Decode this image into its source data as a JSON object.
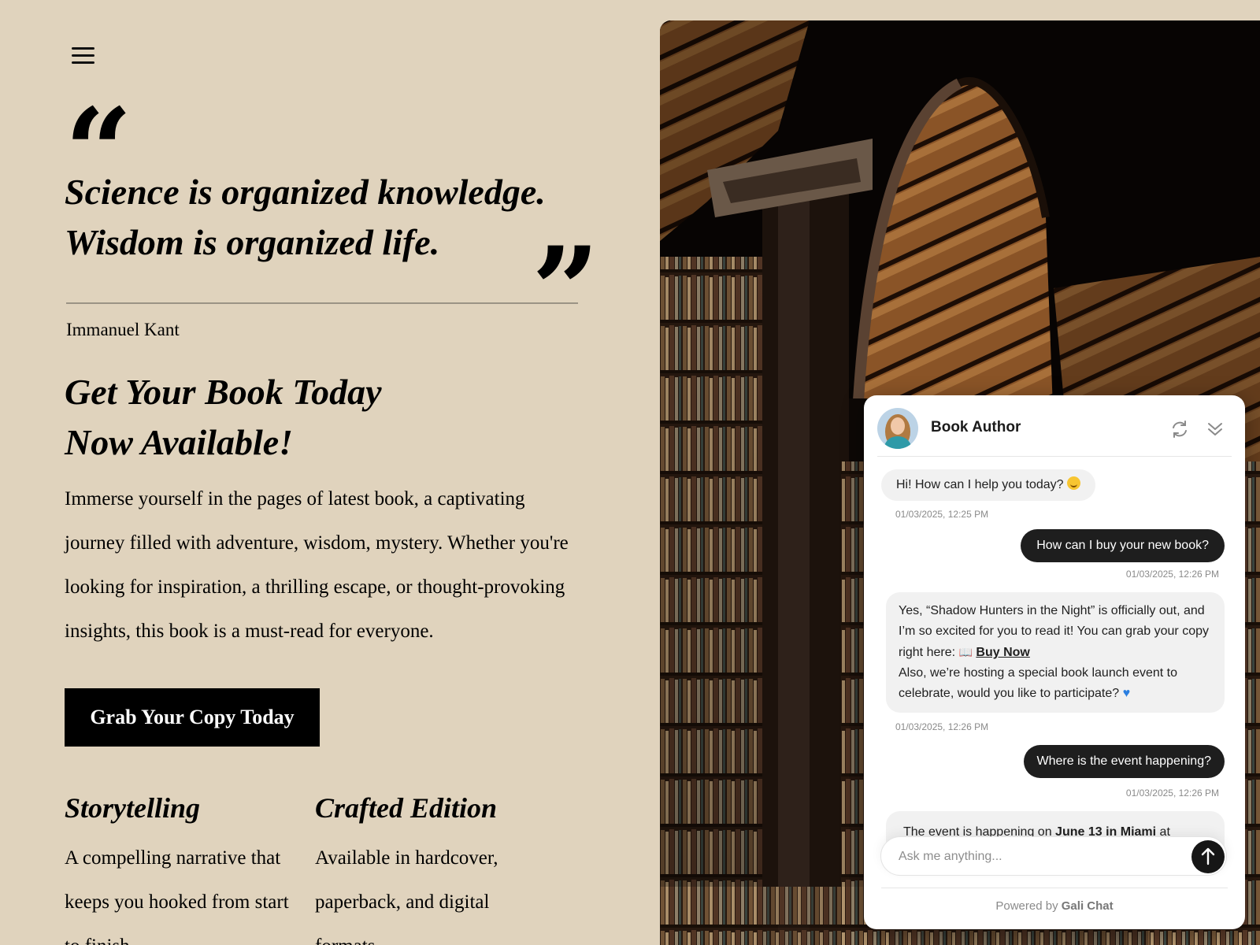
{
  "quote": {
    "line1": "Science is organized knowledge.",
    "line2": "Wisdom is organized life.",
    "author": "Immanuel Kant"
  },
  "headline": {
    "line1": "Get Your Book Today",
    "line2": "Now Available!"
  },
  "intro": "Immerse yourself in the pages of latest book, a captivating journey filled with adventure, wisdom, mystery. Whether you're looking for inspiration, a thrilling escape, or thought-provoking insights, this book is a must-read for everyone.",
  "cta_label": "Grab Your Copy Today",
  "features": [
    {
      "title": "Storytelling",
      "text": "A compelling narrative that keeps you hooked from start to finish."
    },
    {
      "title": "Crafted Edition",
      "text": "Available in hardcover, paperback, and digital formats."
    }
  ],
  "chat": {
    "agent_name": "Book Author",
    "messages": [
      {
        "from": "bot",
        "text": "Hi! How can I help you today?",
        "time": "01/03/2025, 12:25 PM"
      },
      {
        "from": "user",
        "text": "How can I buy your new book?",
        "time": "01/03/2025, 12:26 PM"
      },
      {
        "from": "bot",
        "text_a": "Yes, “Shadow Hunters in the Night” is officially out, and I’m so excited for you to read it! You can grab your copy right here:",
        "link_label": "Buy Now",
        "text_b": "Also, we’re hosting a special book launch event to celebrate, would you like to participate?",
        "time": "01/03/2025, 12:26 PM"
      },
      {
        "from": "user",
        "text": "Where is the event happening?",
        "time": "01/03/2025, 12:26 PM"
      },
      {
        "from": "bot",
        "text_a": "The event is happening on",
        "bold": "June 13 in Miami",
        "text_b": "at"
      }
    ],
    "input_placeholder": "Ask me anything...",
    "footer_prefix": "Powered by",
    "footer_brand": "Gali Chat"
  },
  "icons": {
    "menu": "hamburger-icon",
    "refresh": "refresh-icon",
    "collapse": "double-chevron-down-icon",
    "send": "arrow-up-icon"
  },
  "colors": {
    "page_background": "#e0d3bd",
    "cta_background": "#000000",
    "user_bubble": "#1e1e1e",
    "bot_bubble": "#f1f1f1"
  }
}
